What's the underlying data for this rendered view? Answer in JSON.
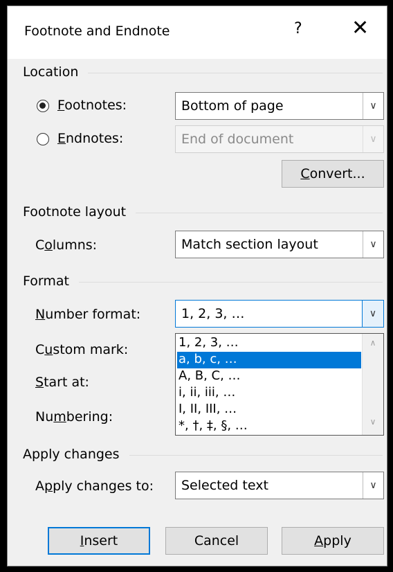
{
  "dialog": {
    "title": "Footnote and Endnote",
    "help_label": "?",
    "close_label": "✕"
  },
  "location": {
    "heading": "Location",
    "footnotes": {
      "label_u": "F",
      "label_rest": "ootnotes:",
      "value": "Bottom of page",
      "checked": true
    },
    "endnotes": {
      "label_u": "E",
      "label_rest": "ndnotes:",
      "value": "End of document",
      "checked": false
    },
    "convert_u": "C",
    "convert_rest": "onvert..."
  },
  "layout": {
    "heading": "Footnote layout",
    "columns_pre": "C",
    "columns_u": "o",
    "columns_rest": "lumns:",
    "columns_value": "Match section layout"
  },
  "format": {
    "heading": "Format",
    "number_format_u": "N",
    "number_format_rest": "umber format:",
    "number_format_value": "1, 2, 3, …",
    "custom_mark_pre": "C",
    "custom_mark_u": "u",
    "custom_mark_rest": "stom mark:",
    "start_at_u": "S",
    "start_at_rest": "tart at:",
    "numbering_pre": "Nu",
    "numbering_u": "m",
    "numbering_rest": "bering:",
    "options": [
      "1, 2, 3, …",
      "a, b, c, …",
      "A, B, C, …",
      "i, ii, iii, …",
      "I, II, III, …",
      "*, †, ‡, §, …"
    ],
    "selected_option": "a, b, c, …"
  },
  "apply": {
    "heading": "Apply changes",
    "apply_to_pre": "A",
    "apply_to_u": "p",
    "apply_to_rest": "ply changes to:",
    "apply_to_value": "Selected text"
  },
  "buttons": {
    "insert_u": "I",
    "insert_rest": "nsert",
    "cancel": "Cancel",
    "apply_u": "A",
    "apply_rest": "pply"
  },
  "icons": {
    "dropdown": "chevron-down-icon",
    "scroll_up": "chevron-up-icon",
    "scroll_down": "chevron-down-icon"
  },
  "colors": {
    "accent": "#0078d7",
    "dialog_bg": "#f0f0f0",
    "titlebar_bg": "#ffffff"
  }
}
